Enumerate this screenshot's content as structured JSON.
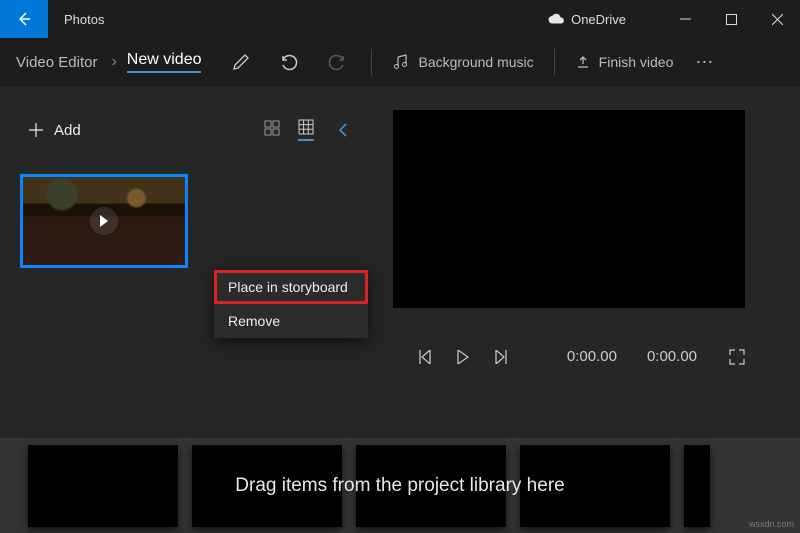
{
  "titlebar": {
    "app_name": "Photos",
    "cloud_label": "OneDrive"
  },
  "toolbar": {
    "breadcrumb_root": "Video Editor",
    "breadcrumb_current": "New video",
    "bg_music_label": "Background music",
    "finish_label": "Finish video"
  },
  "library": {
    "add_label": "Add"
  },
  "context_menu": {
    "place": "Place in storyboard",
    "remove": "Remove"
  },
  "player": {
    "time_current": "0:00.00",
    "time_total": "0:00.00"
  },
  "storyboard": {
    "hint": "Drag items from the project library here"
  },
  "watermark": "wsxdn.com"
}
